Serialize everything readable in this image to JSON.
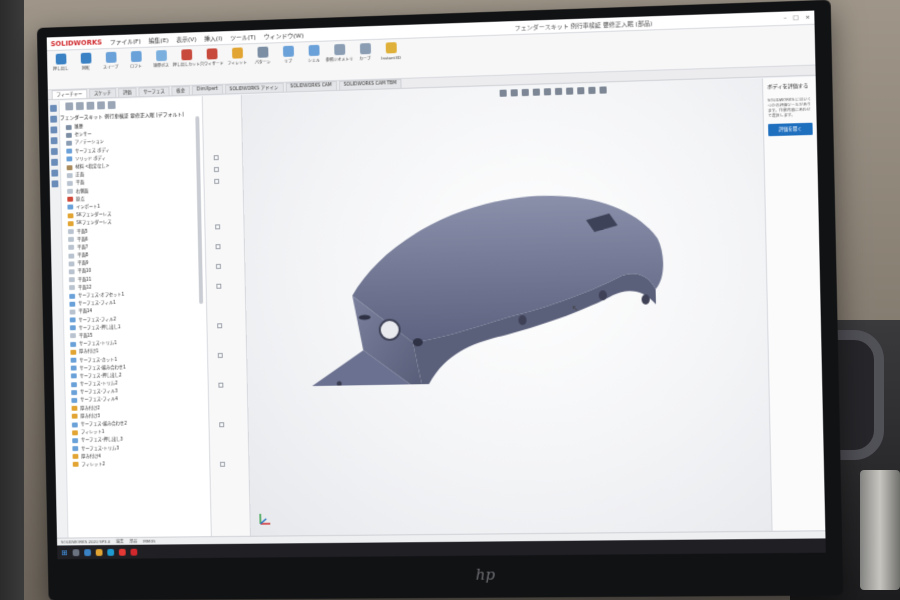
{
  "app": {
    "logo": "SOLIDWORKS",
    "menus": [
      "ファイル(F)",
      "編集(E)",
      "表示(V)",
      "挿入(I)",
      "ツール(T)",
      "ウィンドウ(W)"
    ],
    "document_title": "フェンダースキット 例行車検証 要修正入眠 (部品)"
  },
  "ribbon": {
    "buttons": [
      {
        "label": "押し出し",
        "icon": "extrude-icon",
        "color": "#3b82c4"
      },
      {
        "label": "回転",
        "icon": "revolve-icon",
        "color": "#3b82c4"
      },
      {
        "label": "スイープ",
        "icon": "sweep-icon",
        "color": "#6aa1d8"
      },
      {
        "label": "ロフト",
        "icon": "loft-icon",
        "color": "#6aa1d8"
      },
      {
        "label": "境界ボス",
        "icon": "boundary-icon",
        "color": "#7bb0de"
      },
      {
        "label": "押し出しカット",
        "icon": "cut-extrude-icon",
        "color": "#c84a3c"
      },
      {
        "label": "穴ウィザード",
        "icon": "hole-wizard-icon",
        "color": "#c84a3c"
      },
      {
        "label": "フィレット",
        "icon": "fillet-icon",
        "color": "#e2a533"
      },
      {
        "label": "パターン",
        "icon": "pattern-icon",
        "color": "#7c8ea3"
      },
      {
        "label": "リブ",
        "icon": "rib-icon",
        "color": "#6aa1d8"
      },
      {
        "label": "シェル",
        "icon": "shell-icon",
        "color": "#6aa1d8"
      },
      {
        "label": "参照ジオメトリ",
        "icon": "reference-geometry-icon",
        "color": "#8a9db3"
      },
      {
        "label": "カーブ",
        "icon": "curves-icon",
        "color": "#8a9db3"
      },
      {
        "label": "Instant3D",
        "icon": "instant3d-icon",
        "color": "#e0b13a"
      }
    ],
    "tabs": [
      "フィーチャー",
      "スケッチ",
      "評価",
      "サーフェス",
      "板金",
      "DimXpert",
      "SOLIDWORKS アドイン",
      "SOLIDWORKS CAM",
      "SOLIDWORKS CAM TBM"
    ],
    "active_tab": 0
  },
  "tree": {
    "header": "フェンダースキット 例行車検証 要修正入眠 (デフォルト)",
    "items": [
      {
        "label": "履歴",
        "icon": "history-icon",
        "color": "#7c8ea3"
      },
      {
        "label": "センサー",
        "icon": "sensor-icon",
        "color": "#7c8ea3"
      },
      {
        "label": "アノテーション",
        "icon": "annotation-icon",
        "color": "#8a9db3"
      },
      {
        "label": "サーフェス ボディ",
        "icon": "surface-body-icon",
        "color": "#6aa1d8"
      },
      {
        "label": "ソリッド ボディ",
        "icon": "solid-body-icon",
        "color": "#6aa1d8"
      },
      {
        "label": "材料 <指定なし>",
        "icon": "material-icon",
        "color": "#a98b5c"
      },
      {
        "label": "正面",
        "icon": "plane-icon",
        "color": "#b9c3cf"
      },
      {
        "label": "平面",
        "icon": "plane-icon",
        "color": "#b9c3cf"
      },
      {
        "label": "右側面",
        "icon": "plane-icon",
        "color": "#b9c3cf"
      },
      {
        "label": "原点",
        "icon": "origin-icon",
        "color": "#d04a3c"
      },
      {
        "label": "インポート1",
        "icon": "import-icon",
        "color": "#6aa1d8"
      },
      {
        "label": "SKフェンダーレス",
        "icon": "part-icon",
        "color": "#e2a533"
      },
      {
        "label": "SKフェンダーレス",
        "icon": "part-icon",
        "color": "#e2a533"
      },
      {
        "label": "平面5",
        "icon": "plane-icon",
        "color": "#b9c3cf"
      },
      {
        "label": "平面6",
        "icon": "plane-icon",
        "color": "#b9c3cf"
      },
      {
        "label": "平面7",
        "icon": "plane-icon",
        "color": "#b9c3cf"
      },
      {
        "label": "平面8",
        "icon": "plane-icon",
        "color": "#b9c3cf"
      },
      {
        "label": "平面9",
        "icon": "plane-icon",
        "color": "#b9c3cf"
      },
      {
        "label": "平面10",
        "icon": "plane-icon",
        "color": "#b9c3cf"
      },
      {
        "label": "平面11",
        "icon": "plane-icon",
        "color": "#b9c3cf"
      },
      {
        "label": "平面12",
        "icon": "plane-icon",
        "color": "#b9c3cf"
      },
      {
        "label": "サーフェス-オフセット1",
        "icon": "surface-icon",
        "color": "#6aa1d8"
      },
      {
        "label": "サーフェス-フィル1",
        "icon": "surface-icon",
        "color": "#6aa1d8"
      },
      {
        "label": "平面14",
        "icon": "plane-icon",
        "color": "#b9c3cf"
      },
      {
        "label": "サーフェス-フィル2",
        "icon": "surface-icon",
        "color": "#6aa1d8"
      },
      {
        "label": "サーフェス-押し出し1",
        "icon": "surface-icon",
        "color": "#6aa1d8"
      },
      {
        "label": "平面15",
        "icon": "plane-icon",
        "color": "#b9c3cf"
      },
      {
        "label": "サーフェス-トリム1",
        "icon": "surface-icon",
        "color": "#6aa1d8"
      },
      {
        "label": "厚み付け1",
        "icon": "thicken-icon",
        "color": "#e2a533"
      },
      {
        "label": "サーフェス-カット1",
        "icon": "surface-icon",
        "color": "#6aa1d8"
      },
      {
        "label": "サーフェス-編み合わせ1",
        "icon": "surface-icon",
        "color": "#6aa1d8"
      },
      {
        "label": "サーフェス-押し出し2",
        "icon": "surface-icon",
        "color": "#6aa1d8"
      },
      {
        "label": "サーフェス-トリム2",
        "icon": "surface-icon",
        "color": "#6aa1d8"
      },
      {
        "label": "サーフェス-フィル3",
        "icon": "surface-icon",
        "color": "#6aa1d8"
      },
      {
        "label": "サーフェス-フィル4",
        "icon": "surface-icon",
        "color": "#6aa1d8"
      },
      {
        "label": "厚み付け2",
        "icon": "thicken-icon",
        "color": "#e2a533"
      },
      {
        "label": "厚み付け3",
        "icon": "thicken-icon",
        "color": "#e2a533"
      },
      {
        "label": "サーフェス-編み合わせ2",
        "icon": "surface-icon",
        "color": "#6aa1d8"
      },
      {
        "label": "フィレット1",
        "icon": "fillet-icon",
        "color": "#e2a533"
      },
      {
        "label": "サーフェス-押し出し3",
        "icon": "surface-icon",
        "color": "#6aa1d8"
      },
      {
        "label": "サーフェス-トリム3",
        "icon": "surface-icon",
        "color": "#6aa1d8"
      },
      {
        "label": "厚み付け4",
        "icon": "thicken-icon",
        "color": "#e2a533"
      },
      {
        "label": "フィレット2",
        "icon": "fillet-icon",
        "color": "#e2a533"
      }
    ]
  },
  "task_pane": {
    "title": "ボディを評価する",
    "text": "SOLIDWORKS にはいくつかの評価ツールがあります。作業内容にあわせて選択します。",
    "button": "評価を開く"
  },
  "status": {
    "left": "SOLIDWORKS 2020 SP3.0",
    "items": [
      "編集",
      "部品",
      "MMGS"
    ]
  },
  "colors": {
    "model": "#6f7692",
    "accent": "#1f6fbf",
    "brand": "#d0282c"
  }
}
